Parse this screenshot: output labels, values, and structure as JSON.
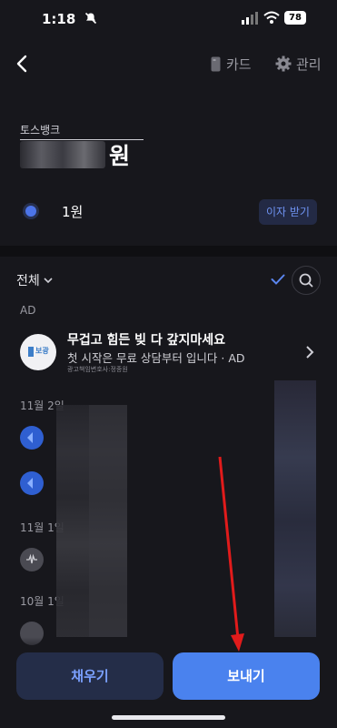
{
  "status_bar": {
    "time": "1:18",
    "battery": "78"
  },
  "header": {
    "card_label": "카드",
    "manage_label": "관리"
  },
  "account": {
    "name": "토스뱅크",
    "balance_suffix": "원",
    "sub_balance": "1원",
    "interest_button": "이자 받기"
  },
  "filter": {
    "label": "전체"
  },
  "ad": {
    "label": "AD",
    "logo_text": "보광",
    "title": "무겁고 힘든 빚 다 갚지마세요",
    "subtitle": "첫 시작은 무료 상담부터 입니다 · AD",
    "small": "광고책임변호사:정종원"
  },
  "transactions": {
    "date1": "11월 2일",
    "date2": "11월 1일",
    "date3": "10월 1일"
  },
  "buttons": {
    "fill": "채우기",
    "send": "보내기"
  },
  "colors": {
    "accent": "#4a82ee",
    "background": "#17171c",
    "annotation_arrow": "#e11b1b"
  }
}
